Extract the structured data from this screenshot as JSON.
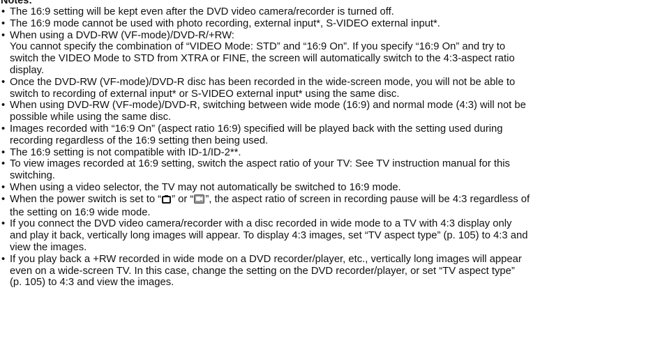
{
  "heading": "Notes:",
  "bullet_char": "•",
  "notes": [
    {
      "lines": [
        "The 16:9 setting will be kept even after the DVD video camera/recorder is turned off."
      ]
    },
    {
      "lines": [
        "The 16:9 mode cannot be used with photo recording, external input*, S-VIDEO external input*."
      ]
    },
    {
      "lines": [
        "When using a DVD-RW (VF-mode)/DVD-R/+RW:",
        "You cannot specify the combination of “VIDEO Mode: STD” and “16:9 On”. If you specify “16:9 On” and try to",
        "switch the VIDEO Mode to STD from XTRA or FINE, the screen will automatically switch to the 4:3-aspect ratio",
        "display."
      ]
    },
    {
      "lines": [
        "Once the DVD-RW (VF-mode)/DVD-R disc has been recorded in the wide-screen mode, you will not be able to",
        "switch to recording of external input* or S-VIDEO external input* using the same disc."
      ]
    },
    {
      "lines": [
        "When using DVD-RW (VF-mode)/DVD-R, switching between wide mode (16:9) and normal mode (4:3) will not be",
        "possible while using the same disc."
      ]
    },
    {
      "lines": [
        "Images recorded with “16:9 On” (aspect ratio 16:9) specified will be played back with the setting used during",
        "recording regardless of the 16:9 setting then being used."
      ]
    },
    {
      "lines": [
        "The 16:9 setting is not compatible with ID-1/ID-2**."
      ]
    },
    {
      "lines": [
        "To view images recorded at 16:9 setting, switch the aspect ratio of your TV: See TV instruction manual for this",
        "switching."
      ]
    },
    {
      "lines": [
        "When using a video selector, the TV may not automatically be switched to 16:9 mode."
      ]
    },
    {
      "power_note": {
        "pre": "When the power switch is set to “",
        "icon1": "camera-icon",
        "mid": "” or “",
        "icon2": "video-mode-icon",
        "post": "”, the aspect ratio of screen in recording pause will be 4:3 regardless of",
        "line2": "the setting on 16:9 wide mode."
      }
    },
    {
      "lines": [
        "If you connect the DVD video camera/recorder with a disc recorded in wide mode to a TV with 4:3 display only",
        "and play it back, vertically long images will appear. To display 4:3 images, set “TV aspect type” (p. 105) to 4:3 and",
        "view the images."
      ]
    },
    {
      "lines": [
        "If you play back a +RW recorded in wide mode on a DVD recorder/player, etc., vertically long images will appear",
        "even on a wide-screen TV. In this case, change the setting on the DVD recorder/player, or set “TV aspect type”",
        "(p. 105) to 4:3 and view the images."
      ]
    }
  ]
}
